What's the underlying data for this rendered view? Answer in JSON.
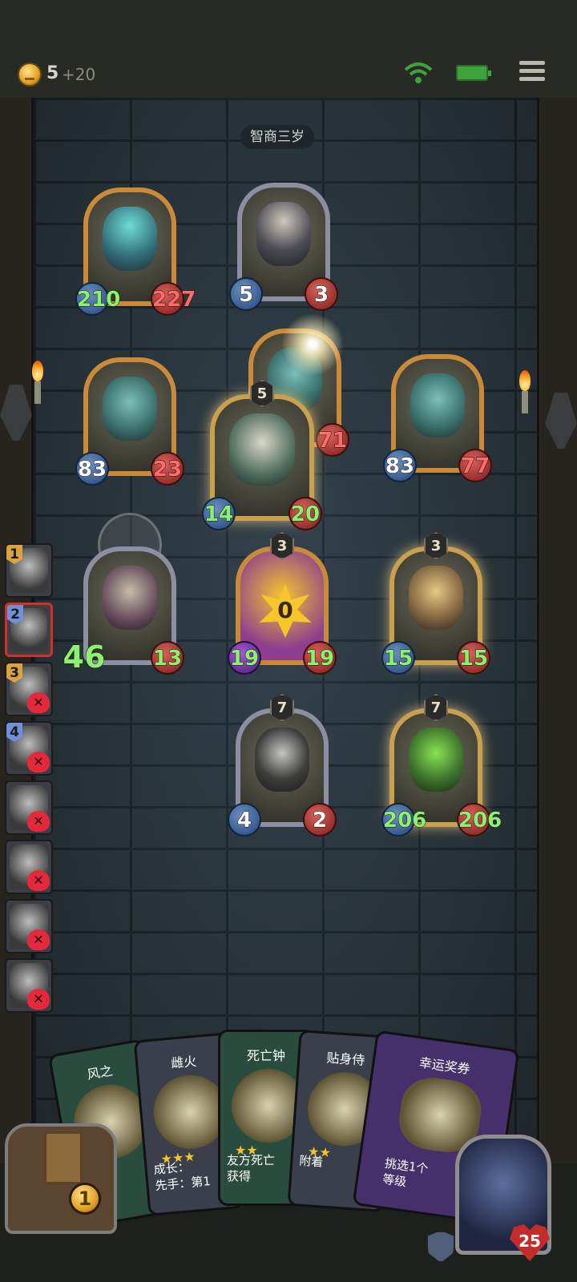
{
  "topbar": {
    "gold": "5",
    "gold_bonus": "+20"
  },
  "opponent": {
    "name": "智商三岁"
  },
  "board": {
    "enemy": [
      {
        "art": "ghost-beast",
        "atk": "210",
        "hp": "227"
      },
      {
        "art": "skull-cultist",
        "atk": "5",
        "hp": "3"
      },
      {
        "art": "teal-drake",
        "atk": "83",
        "hp": "23"
      },
      {
        "art": "teal-drake",
        "hp": "71"
      },
      {
        "art": "teal-drake",
        "atk": "83",
        "hp": "77"
      }
    ],
    "attacker": {
      "tier": "5",
      "art": "dragon-lord",
      "atk": "14",
      "hp": "20"
    },
    "friendly": [
      {
        "tier": "",
        "art": "ram-beast",
        "atk": "46",
        "hp": "13"
      },
      {
        "tier": "3",
        "art": "star-totem",
        "star": "0",
        "atk": "19",
        "hp": "19"
      },
      {
        "tier": "3",
        "art": "mummy-priest",
        "atk": "15",
        "hp": "15"
      },
      {
        "tier": "7",
        "art": "dark-knight",
        "atk": "4",
        "hp": "2"
      },
      {
        "tier": "7",
        "art": "green-slime",
        "atk": "206",
        "hp": "206"
      }
    ]
  },
  "sidebar": [
    {
      "num": "1",
      "dead": false
    },
    {
      "num": "2",
      "dead": false
    },
    {
      "num": "3",
      "dead": true
    },
    {
      "num": "4",
      "dead": true
    },
    {
      "num": "",
      "dead": true
    },
    {
      "num": "",
      "dead": true
    },
    {
      "num": "",
      "dead": true
    },
    {
      "num": "",
      "dead": true
    }
  ],
  "hand": [
    {
      "title": "风之",
      "desc": ""
    },
    {
      "title": "雌火",
      "desc": "成长：\n先手：第1"
    },
    {
      "title": "死亡钟",
      "desc": "友方死亡\n获得"
    },
    {
      "title": "贴身侍",
      "desc": "附着"
    },
    {
      "title": "幸运奖券",
      "desc": "挑选1个\n等级"
    }
  ],
  "footer": {
    "coins": "1",
    "hero_hp": "25"
  }
}
